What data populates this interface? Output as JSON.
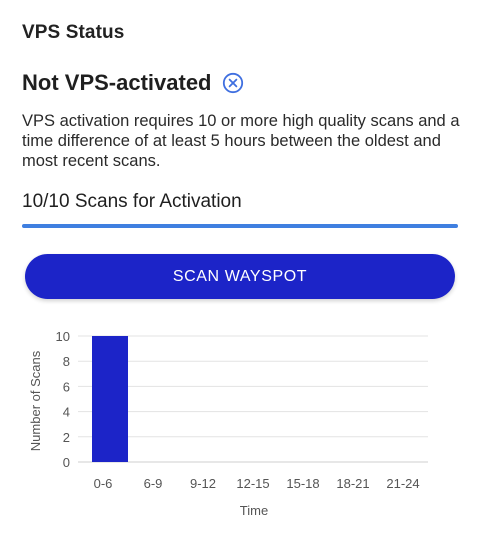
{
  "header": {
    "section_title": "VPS Status"
  },
  "status": {
    "title": "Not VPS-activated",
    "icon": "close-circle-icon",
    "icon_color": "#3f6fe0"
  },
  "description": "VPS activation requires 10 or more high quality scans and a time difference of at least 5 hours between the oldest and most recent scans.",
  "progress": {
    "label": "10/10 Scans for Activation",
    "fraction": 1.0,
    "color": "#3f7fe0"
  },
  "actions": {
    "scan_button_label": "SCAN WAYSPOT",
    "button_color": "#1c24c8"
  },
  "chart_data": {
    "type": "bar",
    "categories": [
      "0-6",
      "6-9",
      "9-12",
      "12-15",
      "15-18",
      "18-21",
      "21-24"
    ],
    "values": [
      10,
      0,
      0,
      0,
      0,
      0,
      0
    ],
    "xlabel": "Time",
    "ylabel": "Number of Scans",
    "ylim": [
      0,
      10
    ],
    "yticks": [
      0,
      2,
      4,
      6,
      8,
      10
    ],
    "grid": true,
    "bar_color": "#1c24c8"
  }
}
